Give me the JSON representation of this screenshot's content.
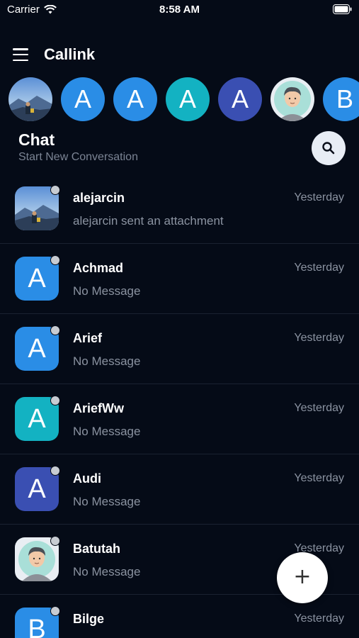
{
  "status_bar": {
    "carrier": "Carrier",
    "time": "8:58 AM"
  },
  "header": {
    "title": "Callink"
  },
  "stories": [
    {
      "type": "photo-mountain",
      "initial": ""
    },
    {
      "type": "letter",
      "initial": "A",
      "color": "#2a8de6"
    },
    {
      "type": "letter",
      "initial": "A",
      "color": "#2a8de6"
    },
    {
      "type": "letter",
      "initial": "A",
      "color": "#13b2c2"
    },
    {
      "type": "letter",
      "initial": "A",
      "color": "#3a4fb2"
    },
    {
      "type": "photo-person",
      "initial": ""
    },
    {
      "type": "letter",
      "initial": "B",
      "color": "#2a8de6"
    }
  ],
  "chat_section": {
    "title": "Chat",
    "subtitle": "Start New Conversation"
  },
  "conversations": [
    {
      "name": "alejarcin",
      "preview": "alejarcin sent an attachment",
      "time": "Yesterday",
      "avatar_type": "photo-mountain",
      "initial": "",
      "color": "#3a78c2"
    },
    {
      "name": "Achmad",
      "preview": "No Message",
      "time": "Yesterday",
      "avatar_type": "letter",
      "initial": "A",
      "color": "#2a8de6"
    },
    {
      "name": "Arief",
      "preview": "No Message",
      "time": "Yesterday",
      "avatar_type": "letter",
      "initial": "A",
      "color": "#2a8de6"
    },
    {
      "name": "AriefWw",
      "preview": "No Message",
      "time": "Yesterday",
      "avatar_type": "letter",
      "initial": "A",
      "color": "#13b2c2"
    },
    {
      "name": "Audi",
      "preview": "No Message",
      "time": "Yesterday",
      "avatar_type": "letter",
      "initial": "A",
      "color": "#3a4fb2"
    },
    {
      "name": "Batutah",
      "preview": "No Message",
      "time": "Yesterday",
      "avatar_type": "photo-person",
      "initial": "",
      "color": "#e9eef3"
    },
    {
      "name": "Bilge",
      "preview": "",
      "time": "Yesterday",
      "avatar_type": "letter",
      "initial": "B",
      "color": "#2a8de6"
    }
  ],
  "icons": {
    "menu": "menu-icon",
    "search": "search-icon",
    "add": "plus-icon",
    "wifi": "wifi-icon",
    "battery": "battery-icon"
  },
  "colors": {
    "background": "#050b17",
    "divider": "#1a2231",
    "muted_text": "#8b93a1",
    "status_dot": "#c8ccd2"
  }
}
